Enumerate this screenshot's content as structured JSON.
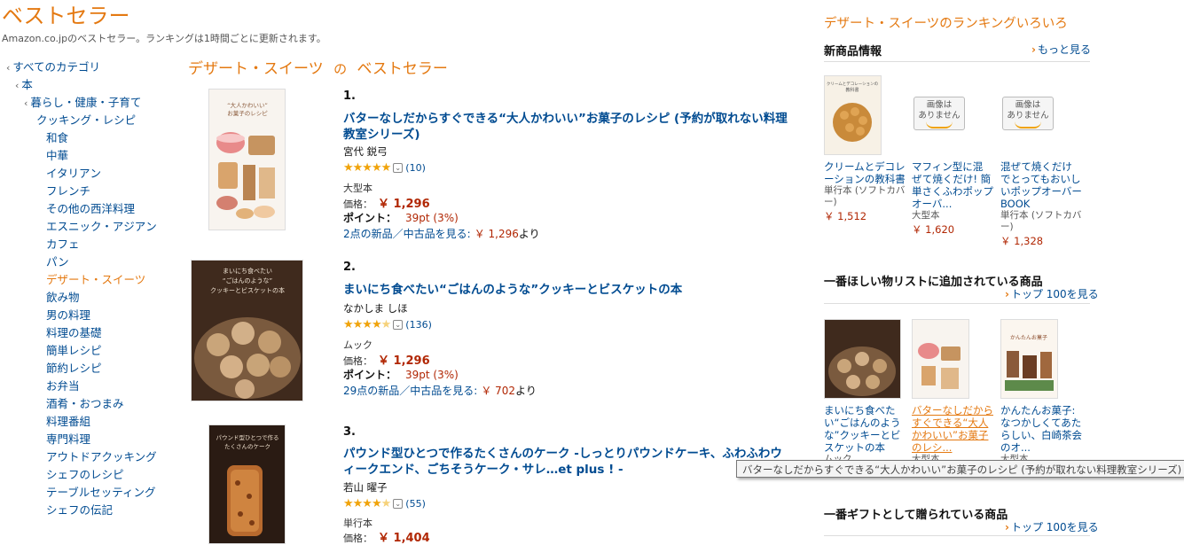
{
  "header": {
    "title": "ベストセラー",
    "subtitle": "Amazon.co.jpのベストセラー。ランキングは1時間ごとに更新されます。"
  },
  "nav": {
    "items": [
      {
        "label": "すべてのカテゴリ",
        "chev": true
      },
      {
        "label": "本",
        "chev": true
      },
      {
        "label": "暮らし・健康・子育て",
        "chev": true
      },
      {
        "label": "クッキング・レシピ"
      },
      {
        "label": "和食"
      },
      {
        "label": "中華"
      },
      {
        "label": "イタリアン"
      },
      {
        "label": "フレンチ"
      },
      {
        "label": "その他の西洋料理"
      },
      {
        "label": "エスニック・アジアン"
      },
      {
        "label": "カフェ"
      },
      {
        "label": "パン"
      },
      {
        "label": "デザート・スイーツ",
        "current": true
      },
      {
        "label": "飲み物"
      },
      {
        "label": "男の料理"
      },
      {
        "label": "料理の基礎"
      },
      {
        "label": "簡単レシピ"
      },
      {
        "label": "節約レシピ"
      },
      {
        "label": "お弁当"
      },
      {
        "label": "酒肴・おつまみ"
      },
      {
        "label": "料理番組"
      },
      {
        "label": "専門料理"
      },
      {
        "label": "アウトドアクッキング"
      },
      {
        "label": "シェフのレシピ"
      },
      {
        "label": "テーブルセッティング"
      },
      {
        "label": "シェフの伝記"
      }
    ]
  },
  "main": {
    "heading_category": "デザート・スイーツ",
    "heading_of": "の",
    "heading_tail": "ベストセラー",
    "items": [
      {
        "rank": "1.",
        "title": "バターなしだからすぐできる“大人かわいい”お菓子のレシピ (予約が取れない料理教室シリーズ)",
        "author": "宮代 鋭弓",
        "rating": 5,
        "reviews": "(10)",
        "format": "大型本",
        "price_label": "価格：",
        "price": "￥ 1,296",
        "points_label": "ポイント：",
        "points": "39pt (3%)",
        "used_text": "2点の新品／中古品を見る:",
        "used_price": "￥ 1,296",
        "used_suffix": "より",
        "cover_text": "“大人かわいい”\nお菓子のレシピ"
      },
      {
        "rank": "2.",
        "title": "まいにち食べたい“ごはんのような”クッキーとビスケットの本",
        "author": "なかしま しほ",
        "rating": 4.5,
        "reviews": "(136)",
        "format": "ムック",
        "price_label": "価格：",
        "price": "￥ 1,296",
        "points_label": "ポイント：",
        "points": "39pt (3%)",
        "used_text": "29点の新品／中古品を見る:",
        "used_price": "￥ 702",
        "used_suffix": "より",
        "cover_text": "まいにち食べたい\n“ごはんのような”\nクッキーとビスケットの本"
      },
      {
        "rank": "3.",
        "title": "パウンド型ひとつで作るたくさんのケーク -しっとりパウンドケーキ、ふわふわウィークエンド、ごちそうケーク・サレ…et plus ! -",
        "author": "若山 曜子",
        "rating": 4.5,
        "reviews": "(55)",
        "format": "単行本",
        "price_label": "価格：",
        "price": "￥ 1,404",
        "cover_text": "パウンド型ひとつで作る\nたくさんのケーク"
      }
    ]
  },
  "right": {
    "title": "デザート・スイーツのランキングいろいろ",
    "new": {
      "heading": "新商品情報",
      "more": "もっと見る",
      "products": [
        {
          "name": "クリームとデコレーションの教科書",
          "meta": "単行本 (ソフトカバー)",
          "price": "￥ 1,512",
          "cover_text": "クリームとデコレーションの教科書"
        },
        {
          "name": "マフィン型に混ぜて焼くだけ! 簡単さくふわポップオーバ...",
          "meta": "大型本",
          "price": "￥ 1,620",
          "noimg": "画像は\nありません"
        },
        {
          "name": "混ぜて焼くだけでとってもおいしいポップオーバーBOOK",
          "meta": "単行本 (ソフトカバー)",
          "price": "￥ 1,328",
          "noimg": "画像は\nありません"
        }
      ]
    },
    "wish": {
      "heading": "一番ほしい物リストに追加されている商品",
      "more": "トップ 100を見る",
      "products": [
        {
          "name": "まいにち食べたい“ごはんのような”クッキーとビスケットの本",
          "meta": "ムック"
        },
        {
          "name": "バターなしだからすぐできる“大人かわいい”お菓子のレシ...",
          "meta": "大型本"
        },
        {
          "name": "かんたんお菓子: なつかしくてあたらしい、白崎茶会のオ...",
          "meta": "大型本",
          "cover_text": "かんたんお菓子"
        }
      ]
    },
    "gift": {
      "heading": "一番ギフトとして贈られている商品",
      "more": "トップ 100を見る"
    }
  },
  "tooltip": "バターなしだからすぐできる“大人かわいい”お菓子のレシピ (予約が取れない料理教室シリーズ)"
}
